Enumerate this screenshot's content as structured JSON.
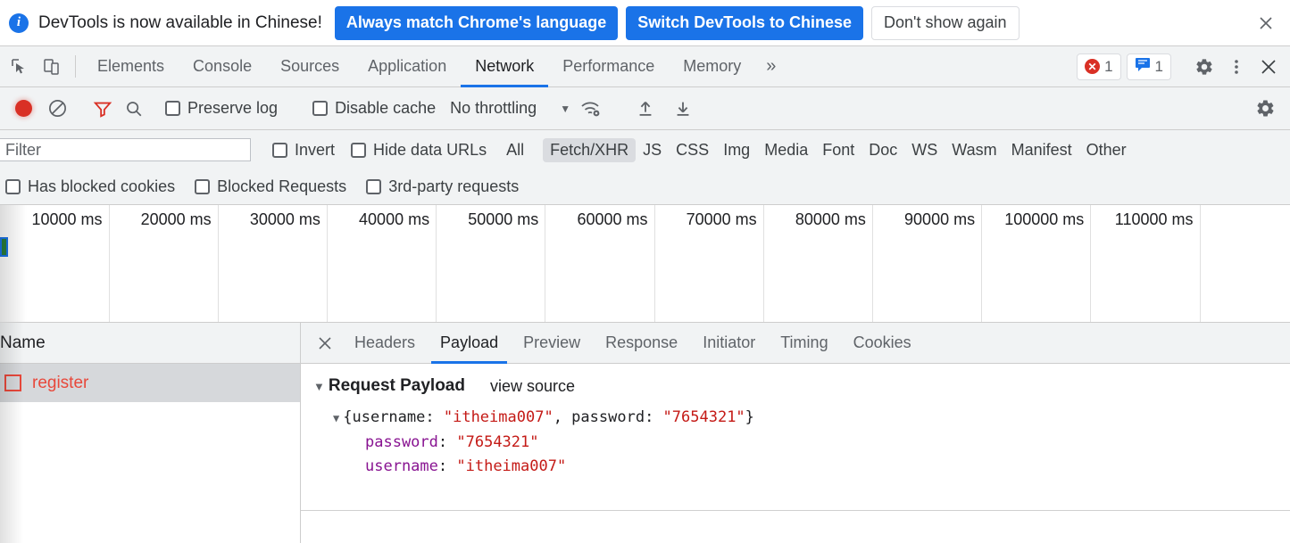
{
  "infobar": {
    "icon": "info-icon",
    "message": "DevTools is now available in Chinese!",
    "primary_button": "Always match Chrome's language",
    "secondary_button": "Switch DevTools to Chinese",
    "dismiss_button": "Don't show again",
    "close_icon": "close-icon",
    "accent_color": "#1a73e8"
  },
  "tabstrip": {
    "inspect_icon": "inspect-element-icon",
    "device_icon": "device-toolbar-icon",
    "tabs": [
      {
        "label": "Elements",
        "active": false
      },
      {
        "label": "Console",
        "active": false
      },
      {
        "label": "Sources",
        "active": false
      },
      {
        "label": "Application",
        "active": false
      },
      {
        "label": "Network",
        "active": true
      },
      {
        "label": "Performance",
        "active": false
      },
      {
        "label": "Memory",
        "active": false
      }
    ],
    "more_tabs": "»",
    "error_badge": {
      "icon": "error-circle-icon",
      "count": "1",
      "color": "#d93025"
    },
    "message_badge": {
      "icon": "message-bubble-icon",
      "count": "1",
      "color": "#1a73e8"
    },
    "settings_icon": "gear-icon",
    "kebab_icon": "more-vertical-icon",
    "close_icon": "close-icon"
  },
  "net_toolbar": {
    "record_icon": "record-stop-icon",
    "clear_icon": "clear-network-icon",
    "filter_icon": "filter-funnel-icon",
    "search_icon": "search-icon",
    "preserve_log": {
      "label": "Preserve log",
      "checked": false
    },
    "disable_cache": {
      "label": "Disable cache",
      "checked": false
    },
    "throttling": {
      "value": "No throttling",
      "caret": "▼"
    },
    "network_conditions_icon": "wifi-settings-icon",
    "import_icon": "import-har-icon",
    "export_icon": "export-har-icon",
    "settings_icon": "gear-icon"
  },
  "filter_bar": {
    "filter_placeholder": "Filter",
    "filter_value": "",
    "invert": {
      "label": "Invert",
      "checked": false
    },
    "hide_data_urls": {
      "label": "Hide data URLs",
      "checked": false
    },
    "types": [
      {
        "label": "All",
        "active": false
      },
      {
        "label": "Fetch/XHR",
        "active": true
      },
      {
        "label": "JS",
        "active": false
      },
      {
        "label": "CSS",
        "active": false
      },
      {
        "label": "Img",
        "active": false
      },
      {
        "label": "Media",
        "active": false
      },
      {
        "label": "Font",
        "active": false
      },
      {
        "label": "Doc",
        "active": false
      },
      {
        "label": "WS",
        "active": false
      },
      {
        "label": "Wasm",
        "active": false
      },
      {
        "label": "Manifest",
        "active": false
      },
      {
        "label": "Other",
        "active": false
      }
    ]
  },
  "options_row": {
    "has_blocked_cookies": {
      "label": "Has blocked cookies",
      "checked": false
    },
    "blocked_requests": {
      "label": "Blocked Requests",
      "checked": false
    },
    "third_party_requests": {
      "label": "3rd-party requests",
      "checked": false
    }
  },
  "overview": {
    "ticks": [
      "10000 ms",
      "20000 ms",
      "30000 ms",
      "40000 ms",
      "50000 ms",
      "60000 ms",
      "70000 ms",
      "80000 ms",
      "90000 ms",
      "100000 ms",
      "110000 ms"
    ],
    "request_bar_color": "#2a7d3c"
  },
  "request_list": {
    "column_header": "Name",
    "rows": [
      {
        "name": "register",
        "status": "error",
        "color": "#e8483b",
        "selected": true
      }
    ]
  },
  "detail": {
    "close_icon": "close-icon",
    "tabs": [
      {
        "label": "Headers",
        "active": false
      },
      {
        "label": "Payload",
        "active": true
      },
      {
        "label": "Preview",
        "active": false
      },
      {
        "label": "Response",
        "active": false
      },
      {
        "label": "Initiator",
        "active": false
      },
      {
        "label": "Timing",
        "active": false
      },
      {
        "label": "Cookies",
        "active": false
      }
    ],
    "payload": {
      "section_title": "Request Payload",
      "view_source_label": "view source",
      "expand_triangle": "▼",
      "object_summary": {
        "open": "{",
        "close": "}",
        "parts": [
          {
            "key": "username",
            "sep": ": ",
            "value": "\"itheima007\"",
            "trail": ", "
          },
          {
            "key": "password",
            "sep": ": ",
            "value": "\"7654321\"",
            "trail": ""
          }
        ]
      },
      "properties": [
        {
          "key": "password",
          "sep": ": ",
          "value": "\"7654321\""
        },
        {
          "key": "username",
          "sep": ": ",
          "value": "\"itheima007\""
        }
      ]
    }
  }
}
